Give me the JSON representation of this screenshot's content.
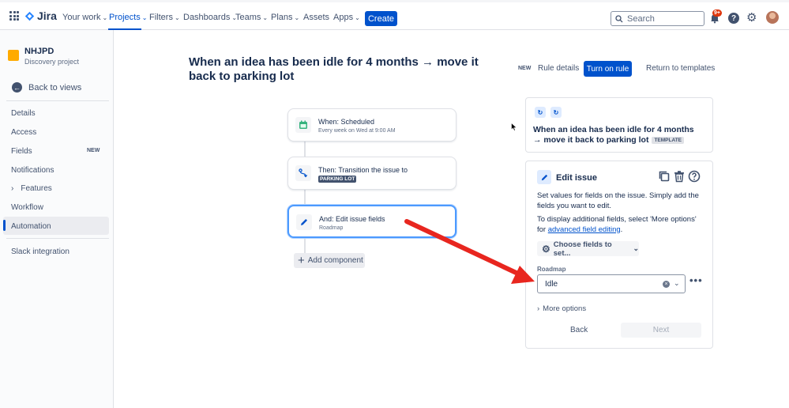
{
  "topnav": {
    "logo_text": "Jira",
    "items": [
      {
        "label": "Your work"
      },
      {
        "label": "Projects"
      },
      {
        "label": "Filters"
      },
      {
        "label": "Dashboards"
      },
      {
        "label": "Teams"
      },
      {
        "label": "Plans"
      },
      {
        "label": "Assets"
      },
      {
        "label": "Apps"
      }
    ],
    "create_label": "Create",
    "search_placeholder": "Search",
    "notification_badge": "9+",
    "accent_color": "#0052cc"
  },
  "sidebar": {
    "project_name": "NHJPD",
    "project_type": "Discovery project",
    "back_label": "Back to views",
    "items": [
      {
        "label": "Details"
      },
      {
        "label": "Access"
      },
      {
        "label": "Fields",
        "badge": "NEW"
      },
      {
        "label": "Notifications"
      },
      {
        "label": "Features"
      },
      {
        "label": "Workflow"
      },
      {
        "label": "Automation"
      },
      {
        "label": "Slack integration"
      }
    ]
  },
  "header": {
    "title": "When an idea has been idle for 4 months → move it back to parking lot",
    "new_badge": "NEW",
    "rule_details": "Rule details",
    "turn_on": "Turn on rule",
    "return_templates": "Return to templates"
  },
  "flow": {
    "steps": [
      {
        "title": "When: Scheduled",
        "sub": "Every week on Wed at 9:00 AM"
      },
      {
        "title": "Then: Transition the issue to",
        "lozenge": "PARKING LOT"
      },
      {
        "title": "And: Edit issue fields",
        "sub": "Roadmap"
      }
    ],
    "add_component": "Add component"
  },
  "template_card": {
    "title": "When an idea has been idle for 4 months → move it back to parking lot",
    "badge": "TEMPLATE"
  },
  "edit_panel": {
    "title": "Edit issue",
    "desc1": "Set values for fields on the issue. Simply add the fields you want to edit.",
    "desc2_prefix": "To display additional fields, select 'More options' for ",
    "desc2_link": "advanced field editing",
    "desc2_suffix": ".",
    "choose_fields": "Choose fields to set...",
    "field_label": "Roadmap",
    "field_value": "Idle",
    "more_options": "More options",
    "back": "Back",
    "next": "Next"
  }
}
